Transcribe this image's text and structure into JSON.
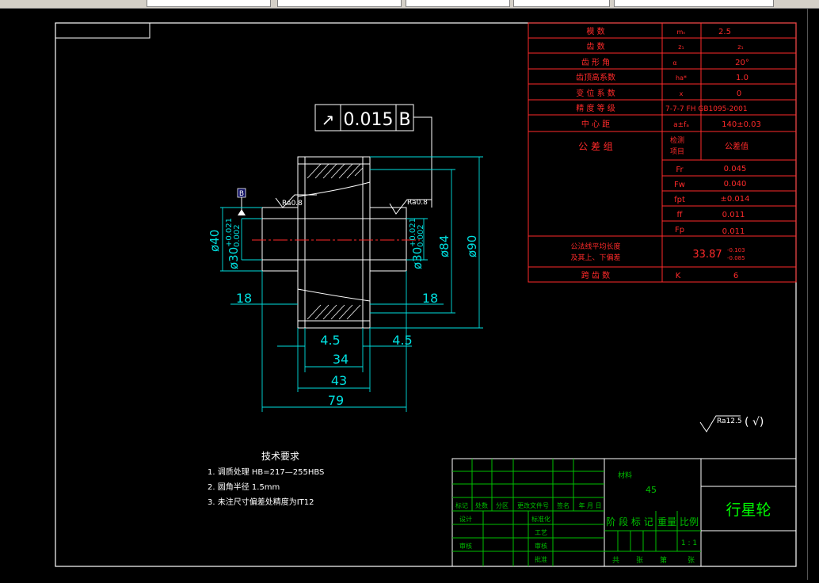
{
  "drawing": {
    "tolerance_frame": {
      "symbol": "↗",
      "value": "0.015",
      "datum": "B"
    },
    "datum_label": "B",
    "roughness_left": "Ra0.8",
    "roughness_right": "Ra0.8",
    "dims": {
      "d40": "ø40",
      "d30_left": "ø30",
      "d30_left_tol_up": "+0.021",
      "d30_left_tol_lo": "0.002",
      "d30_right": "ø30",
      "d30_right_tol_up": "+0.021",
      "d30_right_tol_lo": "0.002",
      "d84": "ø84",
      "d90": "ø90",
      "len18_left": "18",
      "len18_right": "18",
      "len4_5_left": "4.5",
      "len4_5_right": "4.5",
      "len34": "34",
      "len43": "43",
      "len79": "79"
    },
    "general_roughness": "Ra12.5",
    "general_roughness_paren": "( √)",
    "tech_requirements": {
      "title": "技术要求",
      "items": [
        "1. 调质处理 HB=217—255HBS",
        "2. 圆角半径  1.5mm",
        "3. 未注尺寸偏差处精度为IT12"
      ]
    }
  },
  "param_table": {
    "rows": [
      {
        "label": "模    数",
        "symbol": "mₙ",
        "value": "2.5"
      },
      {
        "label": "齿    数",
        "symbol": "z₁",
        "value": "z₁"
      },
      {
        "label": "齿 形 角",
        "symbol": "α",
        "value": "20°"
      },
      {
        "label": "齿顶高系数",
        "symbol": "ha*",
        "value": "1.0"
      },
      {
        "label": "变 位 系 数",
        "symbol": "x",
        "value": "0"
      },
      {
        "label": "精 度 等 级",
        "symbol": "7-7-7 FH GB1095-2001",
        "value": ""
      },
      {
        "label": "中 心 距",
        "symbol": "a±fₐ",
        "value": "140±0.03"
      }
    ],
    "group_label": "公 差 组",
    "group_head_1": "检测",
    "group_head_2": "项目",
    "group_head_value": "公差值",
    "group_rows": [
      {
        "symbol": "Fr",
        "value": "0.045"
      },
      {
        "symbol": "Fw",
        "value": "0.040"
      },
      {
        "symbol": "fpt",
        "value": "±0.014"
      },
      {
        "symbol": "ff",
        "value": "0.011"
      },
      {
        "symbol": "Fp",
        "value": "0.011"
      }
    ],
    "span_label_1": "公法线平均长度",
    "span_label_2": "及其上、下偏差",
    "span_value": "33.87",
    "span_tol_up": "-0.103",
    "span_tol_lo": "-0.085",
    "last_label": "跨 齿 数",
    "last_symbol": "K",
    "last_value": "6"
  },
  "title_block": {
    "material_label": "材料",
    "material_value": "45",
    "part_name": "行星轮",
    "headers": [
      "标记",
      "处数",
      "分区",
      "更改文件号",
      "签名",
      "年 月 日"
    ],
    "design": "设计",
    "standardize": "标准化",
    "check_proc": "工艺",
    "review": "审核",
    "audit": "审核",
    "approve": "批准",
    "approve2": "批准",
    "stage_mark": "阶 段 标 记",
    "weight": "重量",
    "ratio": "比例",
    "ratio_value": "1 : 1",
    "sheet_total": "共",
    "sheet_unit": "张",
    "sheet_no": "第",
    "sheet_unit2": "张"
  }
}
